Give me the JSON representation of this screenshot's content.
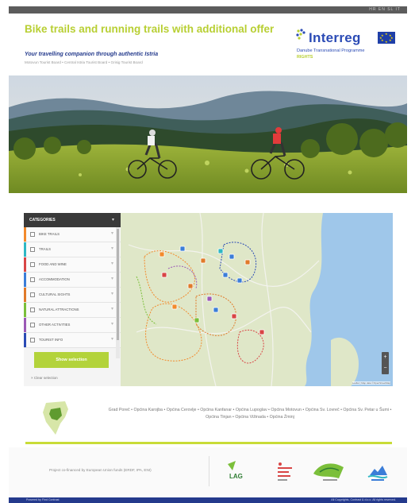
{
  "topbar": {
    "language": "HR  EN  SL  IT"
  },
  "header": {
    "title": "Bike trails and running trails with additional offer",
    "subtitle": "Your travelling companion through authentic Istria",
    "tagline": "Motovun Tourist Board • Central Istria Tourist Board • Grisig Tourist Board"
  },
  "logo": {
    "name": "Interreg",
    "programme": "Danube Transnational Programme",
    "project": "RIGHTS"
  },
  "categories": {
    "header": "CATEGORIES",
    "items": [
      {
        "label": "BIKE TRAILS",
        "color": "#f28a2c"
      },
      {
        "label": "TRAILS",
        "color": "#2fb7c4"
      },
      {
        "label": "FOOD AND WINE",
        "color": "#d84545"
      },
      {
        "label": "ACCOMMODATION",
        "color": "#3b7dd8"
      },
      {
        "label": "CULTURAL SIGHTS",
        "color": "#e07a2a"
      },
      {
        "label": "NATURAL ATTRACTIONS",
        "color": "#7bbf3a"
      },
      {
        "label": "OTHER ACTIVITIES",
        "color": "#9b59b6"
      },
      {
        "label": "TOURIST INFO",
        "color": "#2b4bb5"
      }
    ],
    "show_button": "Show selection",
    "clear_link": "× Clear selection"
  },
  "map": {
    "zoom_in": "+",
    "zoom_out": "−",
    "attribution": "Leaflet | Map data ©OpenStreetMap"
  },
  "municipalities": "Grad Poreč • Općina Karojba • Općina Cerovlje • Općina Kanfanar • Općina Lupoglav • Općina Motovun • Općina Sv. Lovreč • Općina Sv. Petar u Šumi • Općina Tinjan • Općina Vižinada • Općina Žminj",
  "footer": {
    "funded": "Project co-financed by European Union funds (ERDF, IPA, ENI)",
    "partners": [
      "LAG",
      "TZ",
      "Motovun",
      "Istra"
    ]
  },
  "bottombar": {
    "left": "Powered by Find Contrast",
    "right": "All Copyrights, Contrast & d.o.o. All rights reserved."
  }
}
